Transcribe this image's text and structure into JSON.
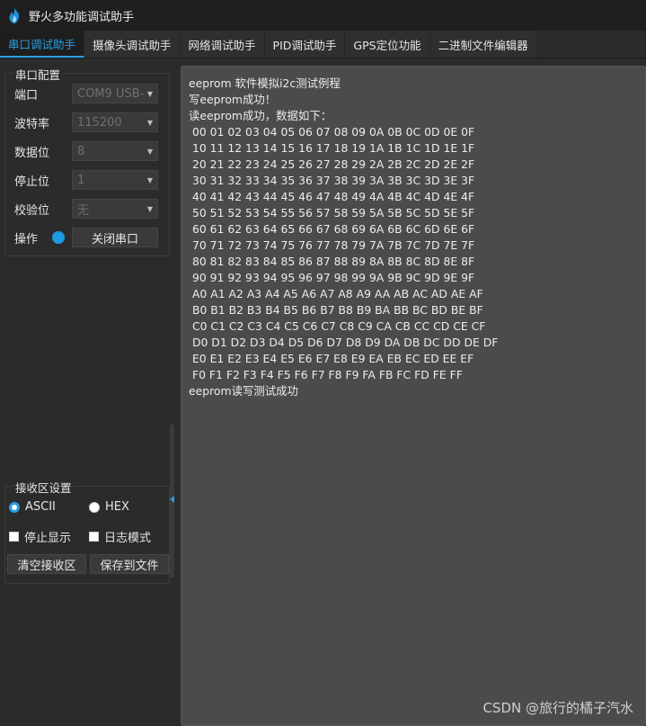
{
  "app": {
    "title": "野火多功能调试助手",
    "colors": {
      "accent": "#2a9fe0",
      "background": "#2b2b2b",
      "receive_bg": "#4b4b4b"
    },
    "icon": "flame-icon"
  },
  "tabs": [
    {
      "label": "串口调试助手",
      "active": true
    },
    {
      "label": "摄像头调试助手",
      "active": false
    },
    {
      "label": "网络调试助手",
      "active": false
    },
    {
      "label": "PID调试助手",
      "active": false
    },
    {
      "label": "GPS定位功能",
      "active": false
    },
    {
      "label": "二进制文件编辑器",
      "active": false
    }
  ],
  "serial_config": {
    "title": "串口配置",
    "port": {
      "label": "端口",
      "value": "COM9 USB-"
    },
    "baud": {
      "label": "波特率",
      "value": "115200"
    },
    "data_bits": {
      "label": "数据位",
      "value": "8"
    },
    "stop_bits": {
      "label": "停止位",
      "value": "1"
    },
    "parity": {
      "label": "校验位",
      "value": "无"
    },
    "operation": {
      "label": "操作",
      "button": "关闭串口"
    }
  },
  "receive_settings": {
    "title": "接收区设置",
    "ascii": "ASCII",
    "hex": "HEX",
    "stop_display": "停止显示",
    "log_mode": "日志模式",
    "clear_button": "清空接收区",
    "save_button": "保存到文件"
  },
  "receive_lines": [
    "eeprom 软件模拟i2c测试例程",
    "写eeprom成功！",
    "读eeprom成功，数据如下：",
    " 00 01 02 03 04 05 06 07 08 09 0A 0B 0C 0D 0E 0F",
    " 10 11 12 13 14 15 16 17 18 19 1A 1B 1C 1D 1E 1F",
    " 20 21 22 23 24 25 26 27 28 29 2A 2B 2C 2D 2E 2F",
    " 30 31 32 33 34 35 36 37 38 39 3A 3B 3C 3D 3E 3F",
    " 40 41 42 43 44 45 46 47 48 49 4A 4B 4C 4D 4E 4F",
    " 50 51 52 53 54 55 56 57 58 59 5A 5B 5C 5D 5E 5F",
    " 60 61 62 63 64 65 66 67 68 69 6A 6B 6C 6D 6E 6F",
    " 70 71 72 73 74 75 76 77 78 79 7A 7B 7C 7D 7E 7F",
    " 80 81 82 83 84 85 86 87 88 89 8A 8B 8C 8D 8E 8F",
    " 90 91 92 93 94 95 96 97 98 99 9A 9B 9C 9D 9E 9F",
    " A0 A1 A2 A3 A4 A5 A6 A7 A8 A9 AA AB AC AD AE AF",
    " B0 B1 B2 B3 B4 B5 B6 B7 B8 B9 BA BB BC BD BE BF",
    " C0 C1 C2 C3 C4 C5 C6 C7 C8 C9 CA CB CC CD CE CF",
    " D0 D1 D2 D3 D4 D5 D6 D7 D8 D9 DA DB DC DD DE DF",
    " E0 E1 E2 E3 E4 E5 E6 E7 E8 E9 EA EB EC ED EE EF",
    " F0 F1 F2 F3 F4 F5 F6 F7 F8 F9 FA FB FC FD FE FF",
    "eeprom读写测试成功"
  ],
  "watermark": "CSDN @旅行的橘子汽水"
}
